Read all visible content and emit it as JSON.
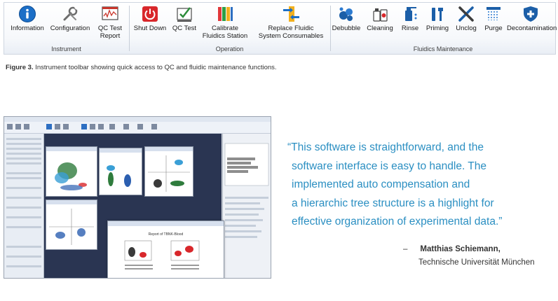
{
  "toolbar": {
    "groups": [
      {
        "label": "Instrument",
        "buttons": [
          {
            "label": "Information",
            "icon": "info-icon"
          },
          {
            "label": "Configuration",
            "icon": "wrench-icon"
          },
          {
            "label": "QC Test\nReport",
            "icon": "qc-report-icon"
          }
        ]
      },
      {
        "label": "Operation",
        "buttons": [
          {
            "label": "Shut Down",
            "icon": "power-icon"
          },
          {
            "label": "QC Test",
            "icon": "qc-test-icon"
          },
          {
            "label": "Calibrate\nFluidics Station",
            "icon": "calibrate-icon"
          },
          {
            "label": "Replace Fluidic\nSystem Consumables",
            "icon": "replace-fluidic-icon"
          }
        ]
      },
      {
        "label": "Fluidics Maintenance",
        "buttons": [
          {
            "label": "Debubble",
            "icon": "debubble-icon"
          },
          {
            "label": "Cleaning",
            "icon": "cleaning-icon"
          },
          {
            "label": "Rinse",
            "icon": "rinse-icon"
          },
          {
            "label": "Priming",
            "icon": "priming-icon"
          },
          {
            "label": "Unclog",
            "icon": "unclog-icon"
          },
          {
            "label": "Purge",
            "icon": "purge-icon"
          },
          {
            "label": "Decontamination",
            "icon": "decontamination-icon"
          }
        ]
      }
    ]
  },
  "caption": {
    "figure": "Figure 3.",
    "text": "Instrument toolbar showing quick access to QC and fluidic maintenance functions."
  },
  "screenshot": {
    "report_title": "Report of TBNK-Blood"
  },
  "quote": {
    "lines": [
      "“This software is straightforward, and the",
      "software interface is easy to handle. The",
      "implemented auto compensation and",
      "a hierarchic tree structure is a highlight for",
      "effective organization of experimental data.”"
    ],
    "dash": "–",
    "author_name": "Matthias Schiemann,",
    "author_affiliation": "Technische Universität München"
  },
  "colors": {
    "quote": "#2b8fc2",
    "ribbon_border": "#cfd6e0",
    "workspace": "#2a3552"
  }
}
